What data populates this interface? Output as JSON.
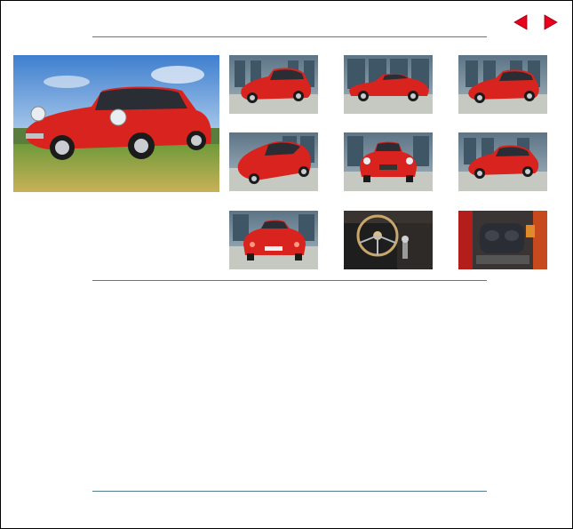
{
  "navigation": {
    "prev_icon": "triangle-left-icon",
    "next_icon": "triangle-right-icon",
    "arrow_color": "#e8001c"
  },
  "gallery": {
    "hero_icon": "car-photo",
    "thumbnails": [
      {
        "icon": "car-front-three-quarter-photo"
      },
      {
        "icon": "car-side-photo"
      },
      {
        "icon": "car-front-three-quarter-photo"
      },
      {
        "icon": "car-rear-three-quarter-photo"
      },
      {
        "icon": "car-front-photo"
      },
      {
        "icon": "car-front-three-quarter-photo"
      },
      {
        "icon": "car-rear-photo"
      },
      {
        "icon": "steering-wheel-interior-photo"
      },
      {
        "icon": "engine-bay-photo"
      }
    ]
  },
  "colors": {
    "car_red": "#d8231e",
    "rule_color": "#4f7f90"
  }
}
